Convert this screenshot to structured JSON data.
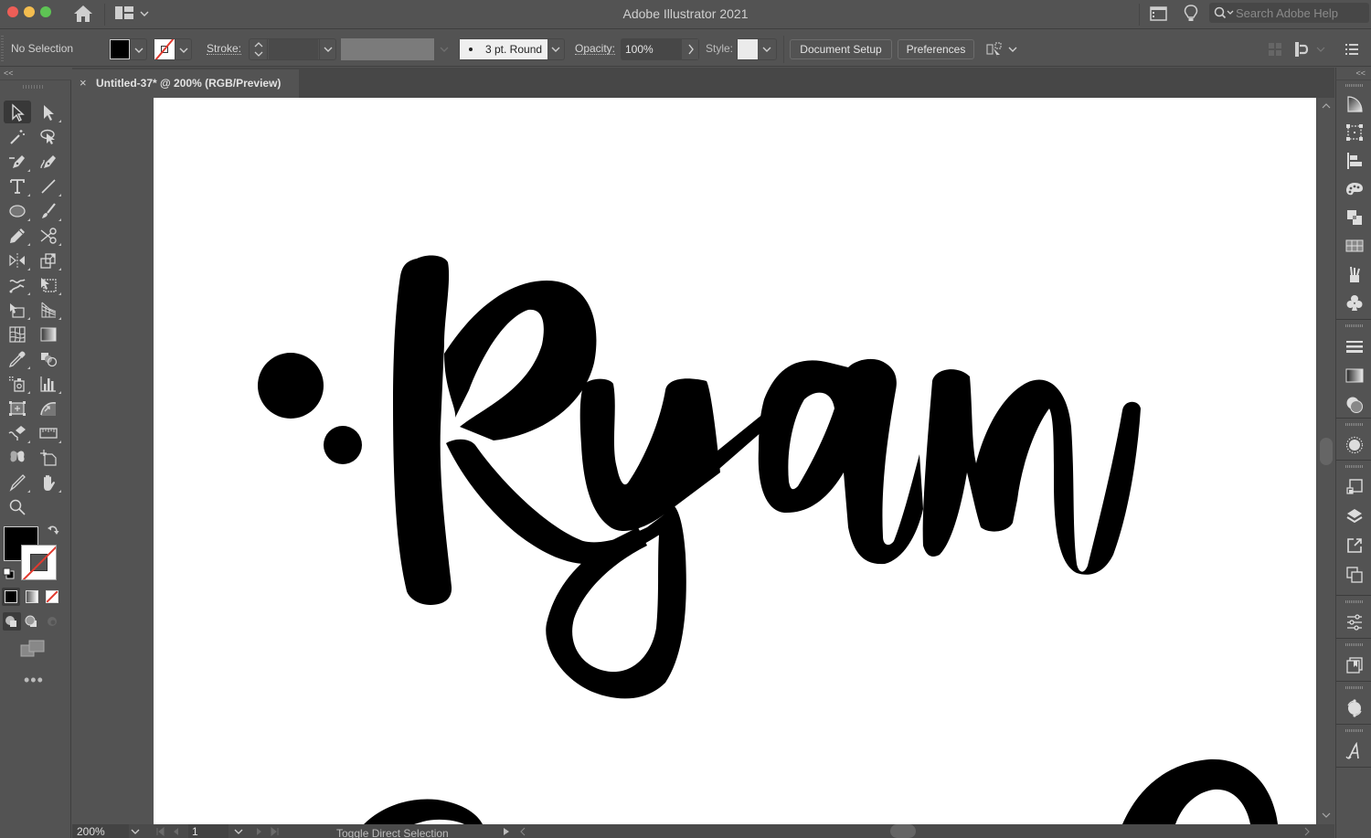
{
  "titlebar": {
    "app_title": "Adobe Illustrator 2021",
    "search_placeholder": "Search Adobe Help"
  },
  "controlbar": {
    "selection_status": "No Selection",
    "fill_color": "#000000",
    "stroke_label": "Stroke:",
    "stroke_weight": "",
    "brush_definition": "3 pt. Round",
    "opacity_label": "Opacity:",
    "opacity_value": "100%",
    "style_label": "Style:",
    "document_setup_label": "Document Setup",
    "preferences_label": "Preferences"
  },
  "document_tab": {
    "close_glyph": "×",
    "title": "Untitled-37* @ 200% (RGB/Preview)"
  },
  "toolbar": {
    "collapse_glyph": "<<",
    "tools": [
      {
        "name": "selection-tool",
        "active": true
      },
      {
        "name": "direct-selection-tool"
      },
      {
        "name": "magic-wand-tool"
      },
      {
        "name": "lasso-tool"
      },
      {
        "name": "pen-tool"
      },
      {
        "name": "curvature-tool"
      },
      {
        "name": "type-tool"
      },
      {
        "name": "line-segment-tool"
      },
      {
        "name": "ellipse-tool"
      },
      {
        "name": "paintbrush-tool"
      },
      {
        "name": "pencil-tool"
      },
      {
        "name": "scissors-tool"
      },
      {
        "name": "reflect-tool"
      },
      {
        "name": "scale-tool"
      },
      {
        "name": "warp-tool"
      },
      {
        "name": "free-transform-tool"
      },
      {
        "name": "shape-builder-tool"
      },
      {
        "name": "perspective-grid-tool"
      },
      {
        "name": "mesh-tool"
      },
      {
        "name": "gradient-tool"
      },
      {
        "name": "eyedropper-tool"
      },
      {
        "name": "blend-tool"
      },
      {
        "name": "symbol-sprayer-tool"
      },
      {
        "name": "column-graph-tool"
      },
      {
        "name": "artboard-tool"
      },
      {
        "name": "puppet-warp-tool"
      },
      {
        "name": "eraser-tool"
      },
      {
        "name": "ruler-tool"
      },
      {
        "name": "image-trace-tool"
      },
      {
        "name": "slice-tool"
      },
      {
        "name": "knife-tool"
      },
      {
        "name": "hand-tool"
      },
      {
        "name": "zoom-tool"
      }
    ],
    "fill_color": "#000000",
    "stroke_color": "none",
    "more_tools_glyph": "•••"
  },
  "artboard": {
    "content_text": "Ryan",
    "fill_color": "#000000",
    "background": "#ffffff"
  },
  "statusbar": {
    "zoom_level": "200%",
    "artboard_number": "1",
    "status_text": "Toggle Direct Selection"
  },
  "right_dock": {
    "collapse_glyph": "<<",
    "groups": [
      [
        "color-guide-icon",
        "transform-icon",
        "align-icon",
        "color-palette-icon",
        "pathfinder-icon",
        "swatches-icon",
        "brushes-icon",
        "symbols-icon"
      ],
      [
        "stroke-icon",
        "gradient-icon",
        "transparency-icon"
      ],
      [
        "appearance-icon"
      ],
      [
        "artboards-icon",
        "layers-icon",
        "export-icon",
        "asset-export-icon"
      ],
      [
        "properties-icon"
      ],
      [
        "libraries-icon"
      ],
      [
        "recolor-icon"
      ],
      [
        "character-icon"
      ]
    ]
  }
}
